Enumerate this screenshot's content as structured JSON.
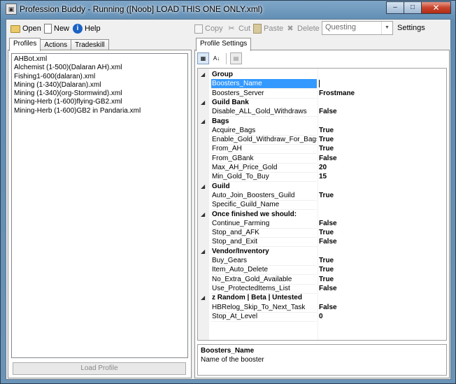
{
  "window": {
    "title": "Profession Buddy - Running ([Noob] LOAD THIS ONE ONLY.xml)",
    "minimize": "–",
    "maximize": "□",
    "close": "✕"
  },
  "toolbar": {
    "open": "Open",
    "new": "New",
    "help": "Help",
    "copy": "Copy",
    "cut": "Cut",
    "paste": "Paste",
    "delete": "Delete",
    "bot_mode": "Questing",
    "settings": "Settings"
  },
  "left_tabs": [
    "Profiles",
    "Actions",
    "Tradeskill"
  ],
  "profiles": [
    "AHBot.xml",
    "Alchemist (1-500)(Dalaran AH).xml",
    "Fishing1-600(dalaran).xml",
    "Mining (1-340)(Dalaran).xml",
    "Mining (1-340)(org-Stormwind).xml",
    "Mining-Herb (1-600)flying-GB2.xml",
    "Mining-Herb (1-600)GB2 in Pandaria.xml"
  ],
  "load_profile": "Load Profile",
  "right_tabs": [
    "Profile Settings"
  ],
  "grid": {
    "categories": [
      {
        "label": "Group",
        "props": [
          [
            "Boosters_Name",
            ""
          ],
          [
            "Boosters_Server",
            "Frostmane"
          ]
        ]
      },
      {
        "label": "Guild Bank",
        "props": [
          [
            "Disable_ALL_Gold_Withdraws",
            "False"
          ]
        ]
      },
      {
        "label": "Bags",
        "props": [
          [
            "Acquire_Bags",
            "True"
          ],
          [
            "Enable_Gold_Withdraw_For_Bags",
            "True"
          ],
          [
            "From_AH",
            "True"
          ],
          [
            "From_GBank",
            "False"
          ],
          [
            "Max_AH_Price_Gold",
            "20"
          ],
          [
            "Min_Gold_To_Buy",
            "15"
          ]
        ]
      },
      {
        "label": "Guild",
        "props": [
          [
            "Auto_Join_Boosters_Guild",
            "True"
          ],
          [
            "Specific_Guild_Name",
            ""
          ]
        ]
      },
      {
        "label": "Once finished we should:",
        "props": [
          [
            "Continue_Farming",
            "False"
          ],
          [
            "Stop_and_AFK",
            "True"
          ],
          [
            "Stop_and_Exit",
            "False"
          ]
        ]
      },
      {
        "label": "Vendor/Inventory",
        "props": [
          [
            "Buy_Gears",
            "True"
          ],
          [
            "Item_Auto_Delete",
            "True"
          ],
          [
            "No_Extra_Gold_Available",
            "True"
          ],
          [
            "Use_ProtectedItems_List",
            "False"
          ]
        ]
      },
      {
        "label": "z  Random | Beta | Untested",
        "props": [
          [
            "HBRelog_Skip_To_Next_Task",
            "False"
          ],
          [
            "Stop_At_Level",
            "0"
          ]
        ]
      }
    ]
  },
  "help": {
    "title": "Boosters_Name",
    "description": "Name of the booster"
  }
}
